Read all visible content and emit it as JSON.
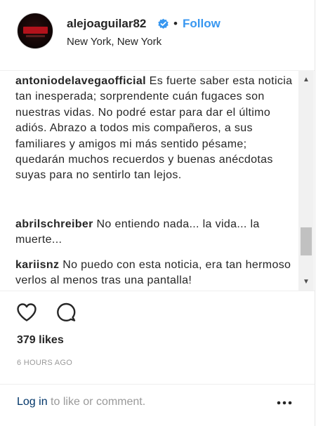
{
  "header": {
    "username": "alejoaguilar82",
    "separator": "•",
    "follow_label": "Follow",
    "location": "New York, New York"
  },
  "comments": [
    {
      "author": "antoniodelavegaofficial",
      "text": "Es fuerte saber esta noticia tan inesperada; sorprendente cuán fugaces son nuestras vidas. No podré estar para dar el último adiós. Abrazo a todos mis compañeros, a sus familiares y amigos mi más sentido pésame; quedarán muchos recuerdos y buenas anécdotas suyas para no sentirlo tan lejos."
    },
    {
      "author": "abrilschreiber",
      "text": "No entiendo nada... la vida... la muerte..."
    },
    {
      "author": "kariisnz",
      "text": "No puedo con esta noticia, era tan hermoso verlos al menos tras una pantalla!"
    }
  ],
  "scrollbar": {
    "up_arrow": "▲",
    "down_arrow": "▼"
  },
  "actions": {
    "likes": "379 likes",
    "time_ago": "6 HOURS AGO"
  },
  "footer": {
    "login_label": "Log in",
    "login_suffix": " to like or comment."
  },
  "icons": {
    "verified": "verified-badge-icon",
    "heart": "heart-icon",
    "comment": "comment-icon",
    "more": "more-options-icon"
  },
  "colors": {
    "link_blue": "#3897f0",
    "text": "#262626",
    "muted": "#999999",
    "login_link": "#003569"
  }
}
